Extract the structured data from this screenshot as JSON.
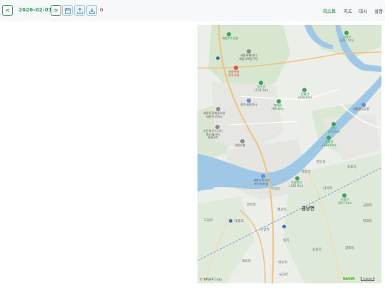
{
  "toolbar": {
    "prev_label": "<",
    "date": "2026-02-01",
    "next_label": ">",
    "count": "0",
    "icons": [
      "calendar-icon",
      "upload-icon",
      "download-icon"
    ]
  },
  "menu": {
    "list": "리스트",
    "map": "지도",
    "dashboard": "대시",
    "settings": "설정"
  },
  "map": {
    "attribution": "© NAVER Corp.",
    "logo": "NAVER",
    "scale": "1000m",
    "places": [
      {
        "name": "세종호수공원",
        "kind": "green"
      },
      {
        "name": "세종특별자치\n세종국책연구단",
        "kind": "gray"
      },
      {
        "name": "세종특별\n자치시청",
        "kind": "red"
      },
      {
        "name": "원수산\n(254.5m)",
        "kind": "green"
      },
      {
        "name": "정부세종청사",
        "kind": "blue"
      },
      {
        "name": "전월산\n(259.6m)",
        "kind": "green"
      },
      {
        "name": "괴화산\n(201.5m)",
        "kind": "green"
      },
      {
        "name": "세종문화예술회관\n대한민국역사",
        "kind": "gray"
      },
      {
        "name": "가든하우스단지\n멀스테이션\n세종2차",
        "kind": "gray"
      },
      {
        "name": "첫마을\n(96.4m)",
        "kind": "green"
      },
      {
        "name": "봉산\n(73.0m)",
        "kind": "green"
      },
      {
        "name": "괴화산\n(283.0m)",
        "kind": "green"
      },
      {
        "name": "세종시청",
        "kind": "gray"
      },
      {
        "name": "세종중앙공원",
        "kind": "gray"
      },
      {
        "name": "세종고속시외\n버스터미널",
        "kind": "blue"
      },
      {
        "name": "나성봉산\n(162.5m)",
        "kind": "green"
      },
      {
        "name": "부강산\n(247.9m)",
        "kind": "green"
      }
    ],
    "areas": [
      "합강리",
      "용포리",
      "호탄리",
      "남곡리",
      "월산리",
      "부강리",
      "성덕리",
      "도암리",
      "금암리",
      "도원리",
      "대평리",
      "동리",
      "송원리",
      "양화리",
      "덕소리",
      "대박리",
      "금남면",
      "영대리",
      "국곡리"
    ]
  }
}
